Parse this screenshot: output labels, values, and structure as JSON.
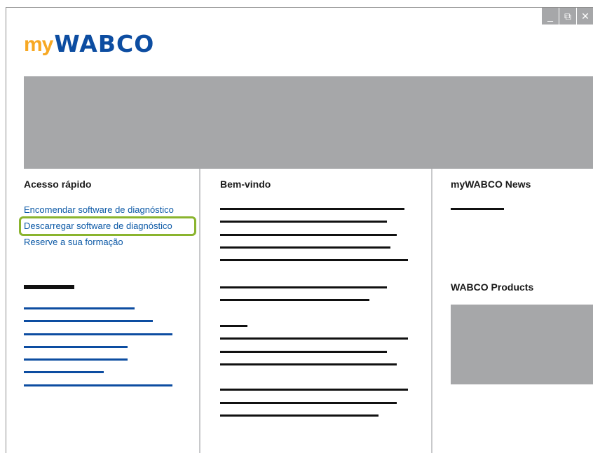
{
  "window": {
    "controls": [
      {
        "name": "minimize-icon",
        "glyph": "_"
      },
      {
        "name": "restore-icon",
        "glyph": "⧉"
      },
      {
        "name": "close-icon",
        "glyph": "✕"
      }
    ]
  },
  "logo": {
    "prefix": "my",
    "brand": "WABCO",
    "prefix_color": "#f7a823",
    "brand_color": "#0d4da1"
  },
  "colors": {
    "link": "#0d5aa7",
    "highlight": "#8ab42e",
    "placeholder": "#a6a7a9"
  },
  "quick_access": {
    "title": "Acesso rápido",
    "links": [
      "Encomendar software de diagnóstico",
      "Descarregar software de diagnóstico",
      "Reserve a sua formação"
    ],
    "highlighted_index": 1
  },
  "welcome": {
    "title": "Bem-vindo"
  },
  "news": {
    "title": "myWABCO News"
  },
  "products": {
    "title": "WABCO Products"
  }
}
